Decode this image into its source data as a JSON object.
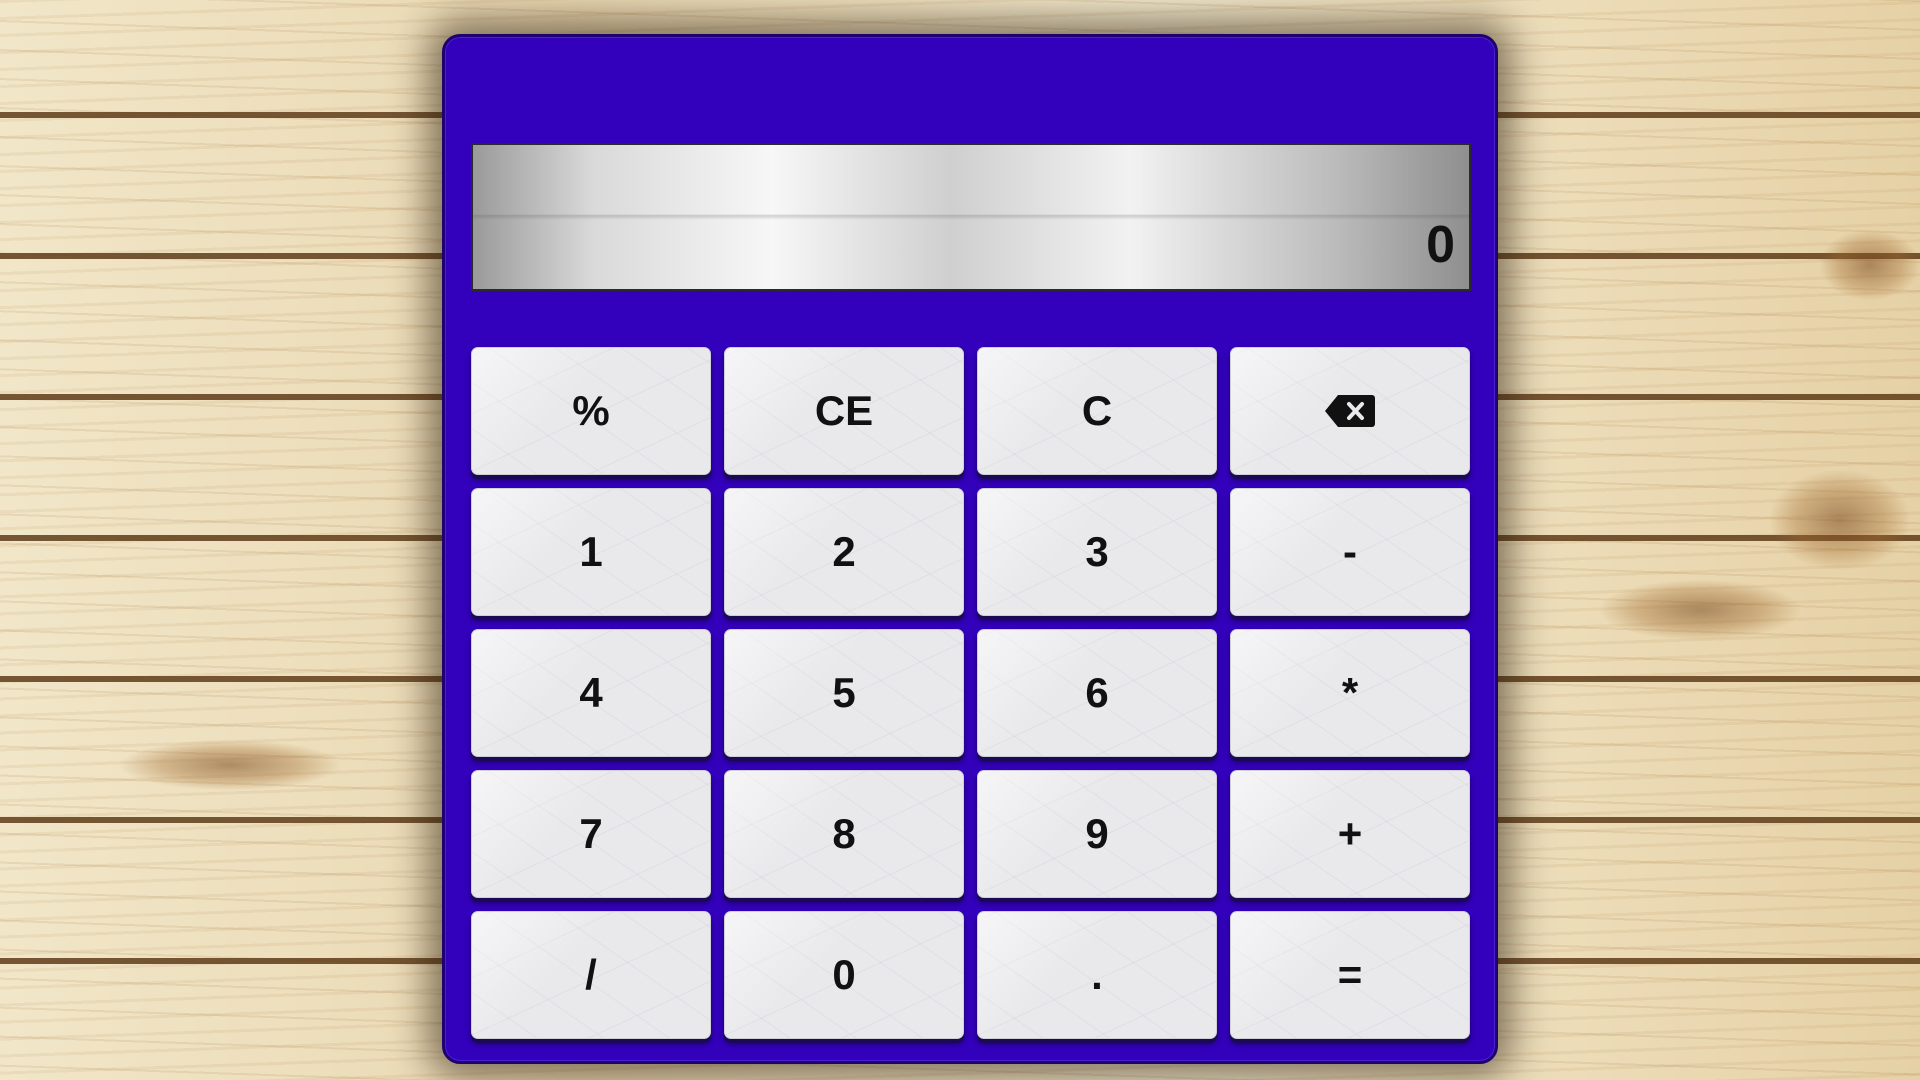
{
  "display": {
    "value": "0"
  },
  "keys": [
    {
      "label": "%",
      "name": "percent-button"
    },
    {
      "label": "CE",
      "name": "clear-entry-button"
    },
    {
      "label": "C",
      "name": "clear-button"
    },
    {
      "label": "",
      "name": "backspace-button",
      "icon": "backspace-icon"
    },
    {
      "label": "1",
      "name": "digit-1-button"
    },
    {
      "label": "2",
      "name": "digit-2-button"
    },
    {
      "label": "3",
      "name": "digit-3-button"
    },
    {
      "label": "-",
      "name": "subtract-button"
    },
    {
      "label": "4",
      "name": "digit-4-button"
    },
    {
      "label": "5",
      "name": "digit-5-button"
    },
    {
      "label": "6",
      "name": "digit-6-button"
    },
    {
      "label": "*",
      "name": "multiply-button"
    },
    {
      "label": "7",
      "name": "digit-7-button"
    },
    {
      "label": "8",
      "name": "digit-8-button"
    },
    {
      "label": "9",
      "name": "digit-9-button"
    },
    {
      "label": "+",
      "name": "add-button"
    },
    {
      "label": "/",
      "name": "divide-button"
    },
    {
      "label": "0",
      "name": "digit-0-button"
    },
    {
      "label": ".",
      "name": "decimal-button"
    },
    {
      "label": "=",
      "name": "equals-button"
    }
  ],
  "colors": {
    "body": "#3300bb",
    "key_face": "#e9e9ec",
    "text": "#111111"
  }
}
